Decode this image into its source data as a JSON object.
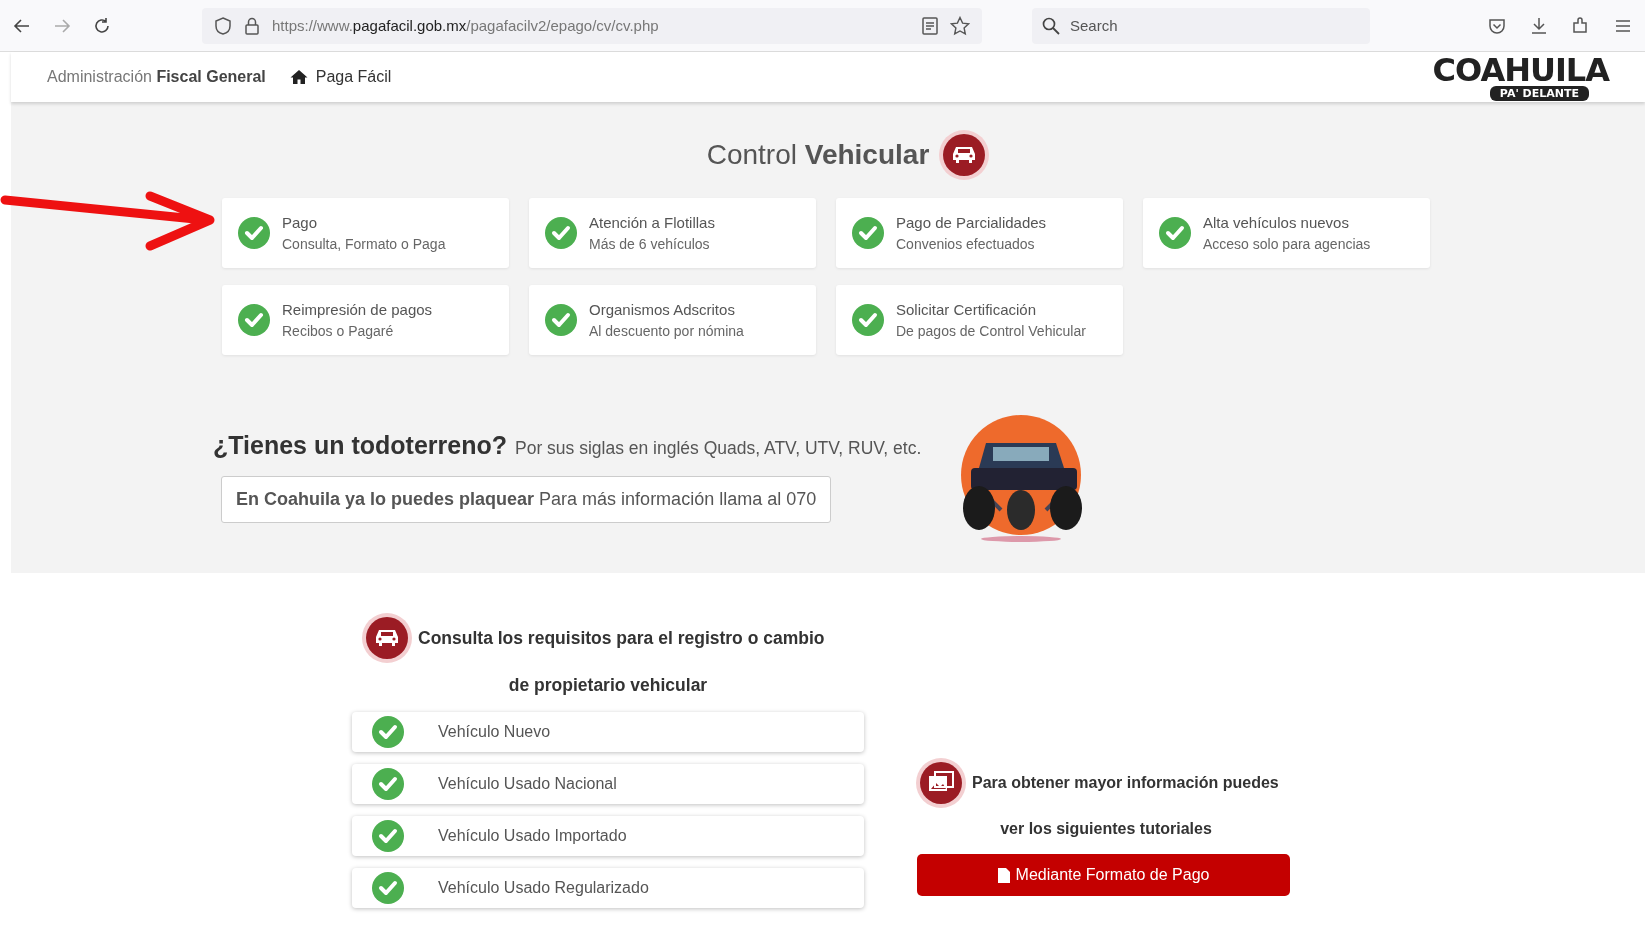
{
  "browser": {
    "url_prefix": "https://www.",
    "url_domain": "pagafacil.gob.mx",
    "url_path": "/pagafacilv2/epago/cv/cv.php",
    "search_placeholder": "Search"
  },
  "header": {
    "agency": "Administración **Fiscal General**",
    "home_link": "Paga Fácil",
    "logo_main": "COAHUILA",
    "logo_tagline": "PA' DELANTE"
  },
  "control": {
    "title": "Control **Vehicular**",
    "services": [
      {
        "title": "Pago",
        "subtitle": "Consulta, Formato o Paga"
      },
      {
        "title": "Atención a Flotillas",
        "subtitle": "Más de 6 vehículos"
      },
      {
        "title": "Pago de Parcialidades",
        "subtitle": "Convenios efectuados"
      },
      {
        "title": "Alta vehículos nuevos",
        "subtitle": "Acceso solo para agencias"
      },
      {
        "title": "Reimpresión de pagos",
        "subtitle": "Recibos o Pagaré"
      },
      {
        "title": "Organismos Adscritos",
        "subtitle": "Al descuento por nómina"
      },
      {
        "title": "Solicitar Certificación",
        "subtitle": "De pagos de Control Vehicular"
      }
    ]
  },
  "offroad": {
    "question": "¿Tienes un todoterreno?",
    "note": "Por sus siglas en inglés Quads, ATV, UTV, RUV, etc.",
    "banner": "**En Coahuila ya lo puedes plaquear** Para más información llama al 070"
  },
  "requirements": {
    "title_line1": "Consulta los requisitos para el registro o cambio",
    "title_line2": "de propietario vehicular",
    "items": [
      "Vehículo Nuevo",
      "Vehículo Usado Nacional",
      "Vehículo Usado Importado",
      "Vehículo Usado Regularizado"
    ]
  },
  "tutorials": {
    "title_line1": "Para obtener mayor información puedes",
    "title_line2": "ver los siguientes tutoriales",
    "buttons": [
      "Mediante Formato de Pago"
    ]
  }
}
